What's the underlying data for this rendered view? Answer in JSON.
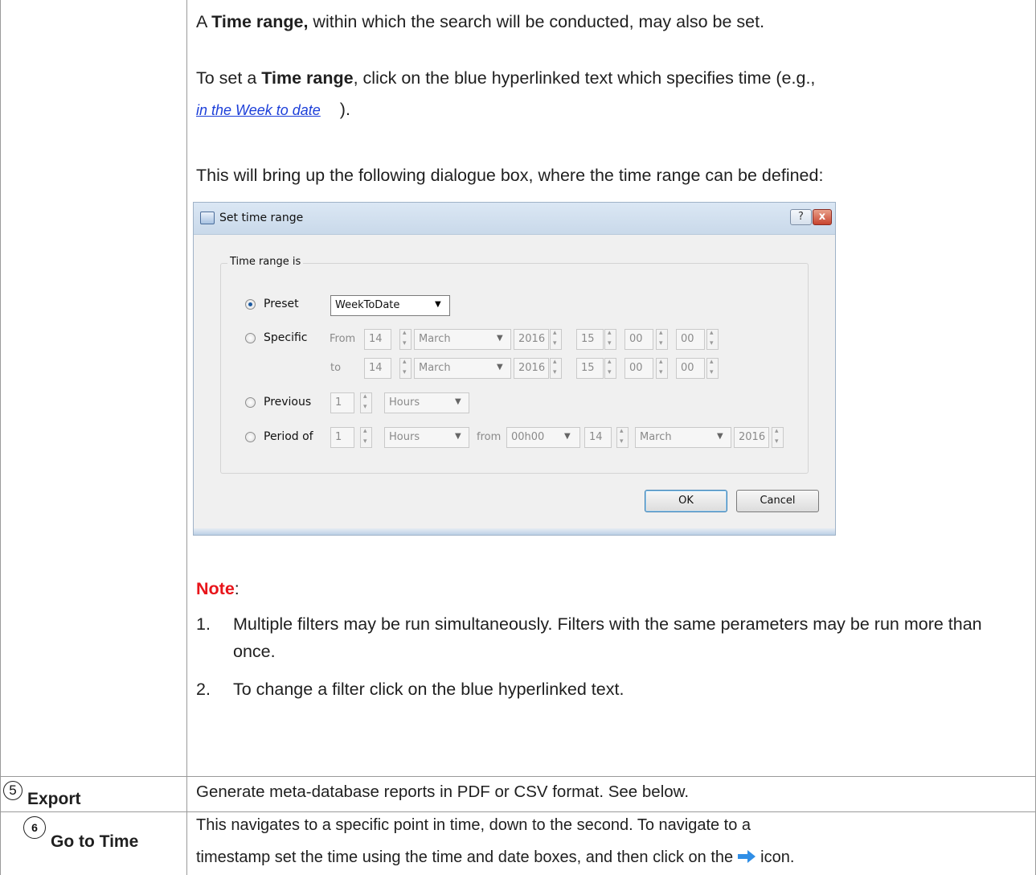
{
  "section": {
    "time_range_para": {
      "prefix": "A ",
      "bold": "Time range,",
      "suffix": " within which the search will be conducted, may also be set."
    },
    "set_range_para": {
      "prefix": "To set a ",
      "bold": "Time range",
      "suffix": ", click on the blue hyperlinked text which specifies time (e.g.,",
      "link_text": "in the Week to date",
      "closing": ")."
    },
    "dialog_intro": "This will bring up the following dialogue box, where the time range can be defined:",
    "note_label": "Note",
    "note_colon": ":",
    "notes": [
      {
        "num": "1.",
        "text": "Multiple filters may be run simultaneously. Filters with the same perameters may be run more than once."
      },
      {
        "num": "2.",
        "text": "To change a filter click on the blue hyperlinked text."
      }
    ]
  },
  "dialog": {
    "title": "Set time range",
    "help_label": "?",
    "close_label": "x",
    "group_label": "Time range is",
    "options": {
      "preset": "Preset",
      "specific": "Specific",
      "previous": "Previous",
      "period_of": "Period of"
    },
    "preset_value": "WeekToDate",
    "from_label": "From",
    "to_label": "to",
    "from": {
      "day": "14",
      "month": "March",
      "year": "2016",
      "hour": "15",
      "minute": "00",
      "second": "00"
    },
    "to": {
      "day": "14",
      "month": "March",
      "year": "2016",
      "hour": "15",
      "minute": "00",
      "second": "00"
    },
    "previous": {
      "count": "1",
      "unit": "Hours"
    },
    "period": {
      "count": "1",
      "unit": "Hours",
      "from_label": "from",
      "time": "00h00",
      "day": "14",
      "month": "March",
      "year": "2016"
    },
    "ok_label": "OK",
    "cancel_label": "Cancel"
  },
  "rows": [
    {
      "number": "5",
      "label": "Export",
      "text": "Generate meta-database reports in PDF or CSV format. See below."
    },
    {
      "number": "6",
      "label": "Go to Time",
      "text_line1": "This navigates to a specific point in time, down to the second. To navigate to a",
      "text_line2a": "timestamp set the time using the time and date boxes, and then click on the",
      "text_line2b": "icon."
    }
  ],
  "icons": {
    "arrow": "right-arrow-icon"
  },
  "colors": {
    "note_red": "#e8141a",
    "link_blue": "#1c3fd9",
    "arrow_blue": "#2f8ee6"
  }
}
